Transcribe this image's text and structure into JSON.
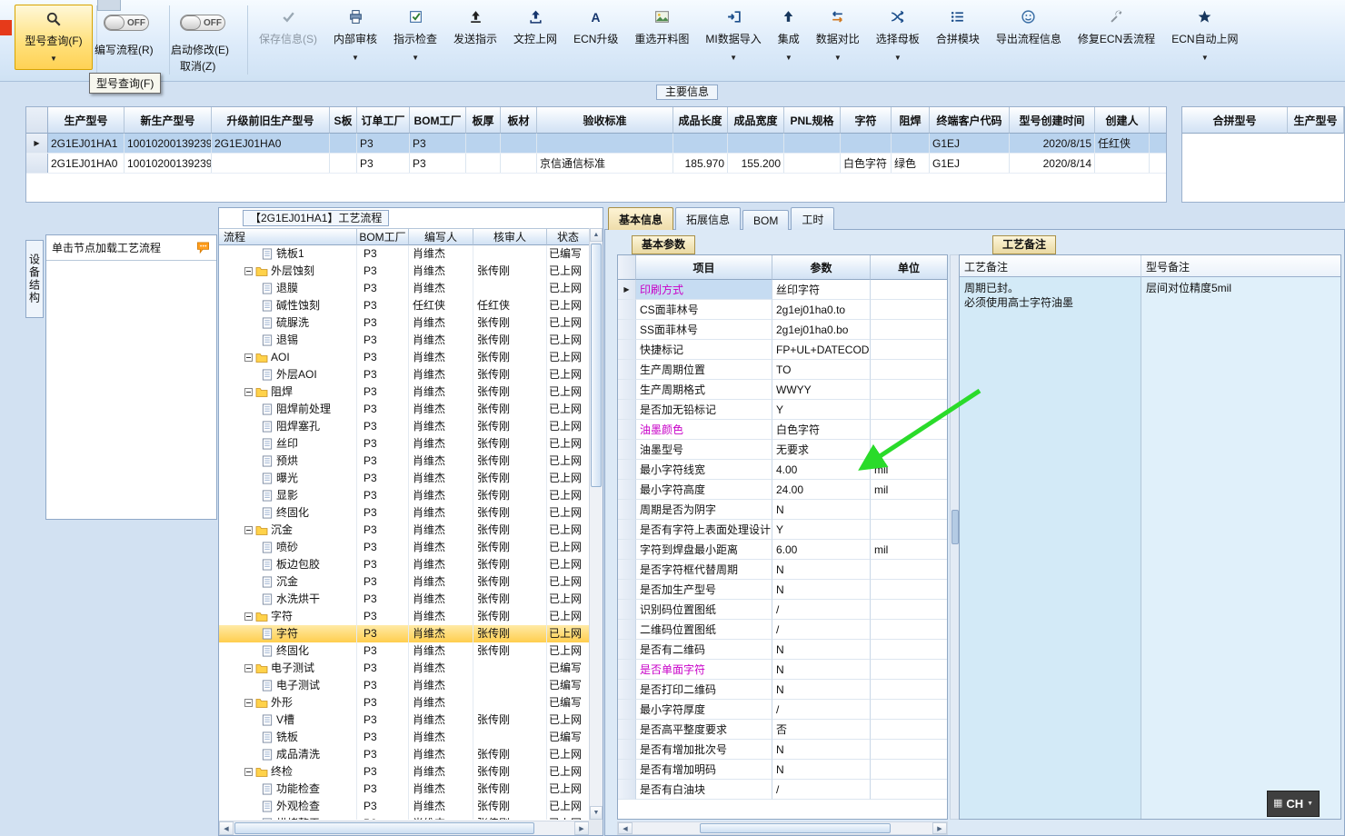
{
  "palette": {
    "selection_blue": "#b9d3ee",
    "highlight_yellow": "#ffd75e",
    "magenta_text": "#c800c8",
    "arrow_green": "#2adb2a"
  },
  "toolbar": {
    "query_button": {
      "label": "型号查询(F)",
      "icon": "search"
    },
    "tooltip": "型号查询(F)",
    "toggle_write": {
      "state": "OFF",
      "label": "编写流程(R)"
    },
    "toggle_modify": {
      "state": "OFF",
      "label": "启动修改(E)",
      "cancel_label": "取消(Z)"
    },
    "buttons": [
      {
        "label": "保存信息(S)",
        "icon": "save",
        "dropdown": false,
        "disabled": true
      },
      {
        "label": "内部审核",
        "icon": "printer",
        "dropdown": true
      },
      {
        "label": "指示检查",
        "icon": "checkbox",
        "dropdown": true
      },
      {
        "label": "发送指示",
        "icon": "send",
        "dropdown": false
      },
      {
        "label": "文控上网",
        "icon": "upload",
        "dropdown": false
      },
      {
        "label": "ECN升级",
        "icon": "letterA",
        "dropdown": false
      },
      {
        "label": "重选开料图",
        "icon": "image",
        "dropdown": false
      },
      {
        "label": "MI数据导入",
        "icon": "import",
        "dropdown": true
      },
      {
        "label": "集成",
        "icon": "integrate",
        "dropdown": true
      },
      {
        "label": "数据对比",
        "icon": "compare",
        "dropdown": true
      },
      {
        "label": "选择母板",
        "icon": "shuffle",
        "dropdown": true
      },
      {
        "label": "合拼模块",
        "icon": "list",
        "dropdown": false
      },
      {
        "label": "导出流程信息",
        "icon": "smiley",
        "dropdown": false
      },
      {
        "label": "修复ECN丢流程",
        "icon": "wrench",
        "dropdown": false
      },
      {
        "label": "ECN自动上网",
        "icon": "star",
        "dropdown": true
      }
    ]
  },
  "main_table": {
    "section_label": "主要信息",
    "columns": [
      "生产型号",
      "新生产型号",
      "升级前旧生产型号",
      "S板",
      "订单工厂",
      "BOM工厂",
      "板厚",
      "板材",
      "验收标准",
      "成品长度",
      "成品宽度",
      "PNL规格",
      "字符",
      "阻焊",
      "终端客户代码",
      "型号创建时间",
      "创建人"
    ],
    "merge_columns": [
      "合拼型号",
      "生产型号"
    ],
    "rows": [
      {
        "selected": true,
        "cells": [
          "2G1EJ01HA1",
          "10010200139239",
          "2G1EJ01HA0",
          "",
          "P3",
          "P3",
          "",
          "",
          "",
          "",
          "",
          "",
          "",
          "",
          "G1EJ",
          "2020/8/15",
          "任红侠"
        ]
      },
      {
        "selected": false,
        "cells": [
          "2G1EJ01HA0",
          "10010200139239",
          "",
          "",
          "P3",
          "P3",
          "",
          "",
          "京信通信标准",
          "185.970",
          "155.200",
          "",
          "白色字符",
          "绿色",
          "G1EJ",
          "2020/8/14",
          ""
        ]
      }
    ]
  },
  "device_tab": "设备结构",
  "hint_panel": {
    "text": "单击节点加载工艺流程"
  },
  "flow_panel": {
    "title": "【2G1EJ01HA1】工艺流程",
    "columns": [
      "流程",
      "BOM工厂",
      "编写人",
      "核审人",
      "状态"
    ],
    "rows": [
      {
        "name": "铣板1",
        "kind": "file",
        "factory": "P3",
        "writer": "肖维杰",
        "reviewer": "",
        "status": "已编写",
        "highlight": false
      },
      {
        "name": "外层蚀刻",
        "kind": "folder",
        "factory": "P3",
        "writer": "肖维杰",
        "reviewer": "张传刚",
        "status": "已上网",
        "highlight": false
      },
      {
        "name": "退膜",
        "kind": "file",
        "factory": "P3",
        "writer": "肖维杰",
        "reviewer": "",
        "status": "已上网",
        "highlight": false
      },
      {
        "name": "碱性蚀刻",
        "kind": "file",
        "factory": "P3",
        "writer": "任红侠",
        "reviewer": "任红侠",
        "status": "已上网",
        "highlight": false
      },
      {
        "name": "硫脲洗",
        "kind": "file",
        "factory": "P3",
        "writer": "肖维杰",
        "reviewer": "张传刚",
        "status": "已上网",
        "highlight": false
      },
      {
        "name": "退锡",
        "kind": "file",
        "factory": "P3",
        "writer": "肖维杰",
        "reviewer": "张传刚",
        "status": "已上网",
        "highlight": false
      },
      {
        "name": "AOI",
        "kind": "folder",
        "factory": "P3",
        "writer": "肖维杰",
        "reviewer": "张传刚",
        "status": "已上网",
        "highlight": false
      },
      {
        "name": "外层AOI",
        "kind": "file",
        "factory": "P3",
        "writer": "肖维杰",
        "reviewer": "张传刚",
        "status": "已上网",
        "highlight": false
      },
      {
        "name": "阻焊",
        "kind": "folder",
        "factory": "P3",
        "writer": "肖维杰",
        "reviewer": "张传刚",
        "status": "已上网",
        "highlight": false
      },
      {
        "name": "阻焊前处理",
        "kind": "file",
        "factory": "P3",
        "writer": "肖维杰",
        "reviewer": "张传刚",
        "status": "已上网",
        "highlight": false
      },
      {
        "name": "阻焊塞孔",
        "kind": "file",
        "factory": "P3",
        "writer": "肖维杰",
        "reviewer": "张传刚",
        "status": "已上网",
        "highlight": false
      },
      {
        "name": "丝印",
        "kind": "file",
        "factory": "P3",
        "writer": "肖维杰",
        "reviewer": "张传刚",
        "status": "已上网",
        "highlight": false
      },
      {
        "name": "预烘",
        "kind": "file",
        "factory": "P3",
        "writer": "肖维杰",
        "reviewer": "张传刚",
        "status": "已上网",
        "highlight": false
      },
      {
        "name": "曝光",
        "kind": "file",
        "factory": "P3",
        "writer": "肖维杰",
        "reviewer": "张传刚",
        "status": "已上网",
        "highlight": false
      },
      {
        "name": "显影",
        "kind": "file",
        "factory": "P3",
        "writer": "肖维杰",
        "reviewer": "张传刚",
        "status": "已上网",
        "highlight": false
      },
      {
        "name": "终固化",
        "kind": "file",
        "factory": "P3",
        "writer": "肖维杰",
        "reviewer": "张传刚",
        "status": "已上网",
        "highlight": false
      },
      {
        "name": "沉金",
        "kind": "folder",
        "factory": "P3",
        "writer": "肖维杰",
        "reviewer": "张传刚",
        "status": "已上网",
        "highlight": false
      },
      {
        "name": "喷砂",
        "kind": "file",
        "factory": "P3",
        "writer": "肖维杰",
        "reviewer": "张传刚",
        "status": "已上网",
        "highlight": false
      },
      {
        "name": "板边包胶",
        "kind": "file",
        "factory": "P3",
        "writer": "肖维杰",
        "reviewer": "张传刚",
        "status": "已上网",
        "highlight": false
      },
      {
        "name": "沉金",
        "kind": "file",
        "factory": "P3",
        "writer": "肖维杰",
        "reviewer": "张传刚",
        "status": "已上网",
        "highlight": false
      },
      {
        "name": "水洗烘干",
        "kind": "file",
        "factory": "P3",
        "writer": "肖维杰",
        "reviewer": "张传刚",
        "status": "已上网",
        "highlight": false
      },
      {
        "name": "字符",
        "kind": "folder",
        "factory": "P3",
        "writer": "肖维杰",
        "reviewer": "张传刚",
        "status": "已上网",
        "highlight": false
      },
      {
        "name": "字符",
        "kind": "file",
        "factory": "P3",
        "writer": "肖维杰",
        "reviewer": "张传刚",
        "status": "已上网",
        "highlight": true
      },
      {
        "name": "终固化",
        "kind": "file",
        "factory": "P3",
        "writer": "肖维杰",
        "reviewer": "张传刚",
        "status": "已上网",
        "highlight": false
      },
      {
        "name": "电子测试",
        "kind": "folder",
        "factory": "P3",
        "writer": "肖维杰",
        "reviewer": "",
        "status": "已编写",
        "highlight": false
      },
      {
        "name": "电子测试",
        "kind": "file",
        "factory": "P3",
        "writer": "肖维杰",
        "reviewer": "",
        "status": "已编写",
        "highlight": false
      },
      {
        "name": "外形",
        "kind": "folder",
        "factory": "P3",
        "writer": "肖维杰",
        "reviewer": "",
        "status": "已编写",
        "highlight": false
      },
      {
        "name": "V槽",
        "kind": "file",
        "factory": "P3",
        "writer": "肖维杰",
        "reviewer": "张传刚",
        "status": "已上网",
        "highlight": false
      },
      {
        "name": "铣板",
        "kind": "file",
        "factory": "P3",
        "writer": "肖维杰",
        "reviewer": "",
        "status": "已编写",
        "highlight": false
      },
      {
        "name": "成品清洗",
        "kind": "file",
        "factory": "P3",
        "writer": "肖维杰",
        "reviewer": "张传刚",
        "status": "已上网",
        "highlight": false
      },
      {
        "name": "终检",
        "kind": "folder",
        "factory": "P3",
        "writer": "肖维杰",
        "reviewer": "张传刚",
        "status": "已上网",
        "highlight": false
      },
      {
        "name": "功能检查",
        "kind": "file",
        "factory": "P3",
        "writer": "肖维杰",
        "reviewer": "张传刚",
        "status": "已上网",
        "highlight": false
      },
      {
        "name": "外观检查",
        "kind": "file",
        "factory": "P3",
        "writer": "肖维杰",
        "reviewer": "张传刚",
        "status": "已上网",
        "highlight": false
      },
      {
        "name": "烘烤整平",
        "kind": "file",
        "factory": "P3",
        "writer": "肖维杰",
        "reviewer": "张传刚",
        "status": "已上网",
        "highlight": false
      }
    ]
  },
  "detail_panel": {
    "tabs": [
      "基本信息",
      "拓展信息",
      "BOM",
      "工时"
    ],
    "active_tab": "基本信息",
    "sub_tab": "基本参数",
    "param_columns": [
      "项目",
      "参数",
      "单位"
    ],
    "params": [
      {
        "name": "印刷方式",
        "value": "丝印字符",
        "unit": "",
        "magenta": true,
        "selected": true
      },
      {
        "name": "CS面菲林号",
        "value": "2g1ej01ha0.to",
        "unit": ""
      },
      {
        "name": "SS面菲林号",
        "value": "2g1ej01ha0.bo",
        "unit": ""
      },
      {
        "name": "快捷标记",
        "value": "FP+UL+DATECODE",
        "unit": ""
      },
      {
        "name": "生产周期位置",
        "value": "TO",
        "unit": ""
      },
      {
        "name": "生产周期格式",
        "value": "WWYY",
        "unit": ""
      },
      {
        "name": "是否加无铅标记",
        "value": "Y",
        "unit": ""
      },
      {
        "name": "油墨颜色",
        "value": "白色字符",
        "unit": "",
        "magenta": true
      },
      {
        "name": "油墨型号",
        "value": "无要求",
        "unit": ""
      },
      {
        "name": "最小字符线宽",
        "value": "4.00",
        "unit": "mil"
      },
      {
        "name": "最小字符高度",
        "value": "24.00",
        "unit": "mil"
      },
      {
        "name": "周期是否为阴字",
        "value": "N",
        "unit": ""
      },
      {
        "name": "是否有字符上表面处理设计",
        "value": "Y",
        "unit": ""
      },
      {
        "name": "字符到焊盘最小距离",
        "value": "6.00",
        "unit": "mil"
      },
      {
        "name": "是否字符框代替周期",
        "value": "N",
        "unit": ""
      },
      {
        "name": "是否加生产型号",
        "value": "N",
        "unit": ""
      },
      {
        "name": "识别码位置图纸",
        "value": "/",
        "unit": ""
      },
      {
        "name": "二维码位置图纸",
        "value": "/",
        "unit": ""
      },
      {
        "name": "是否有二维码",
        "value": "N",
        "unit": ""
      },
      {
        "name": "是否单面字符",
        "value": "N",
        "unit": "",
        "magenta": true
      },
      {
        "name": "是否打印二维码",
        "value": "N",
        "unit": ""
      },
      {
        "name": "最小字符厚度",
        "value": "/",
        "unit": ""
      },
      {
        "name": "是否高平整度要求",
        "value": "否",
        "unit": ""
      },
      {
        "name": "是否有增加批次号",
        "value": "N",
        "unit": ""
      },
      {
        "name": "是否有增加明码",
        "value": "N",
        "unit": ""
      },
      {
        "name": "是否有白油块",
        "value": "/",
        "unit": ""
      }
    ]
  },
  "remarks_panel": {
    "tab": "工艺备注",
    "columns": [
      "工艺备注",
      "型号备注"
    ],
    "process_remark": "周期已封。\n必须使用高士字符油墨",
    "model_remark": "层间对位精度5mil"
  },
  "status_bar": {
    "language": "CH"
  }
}
